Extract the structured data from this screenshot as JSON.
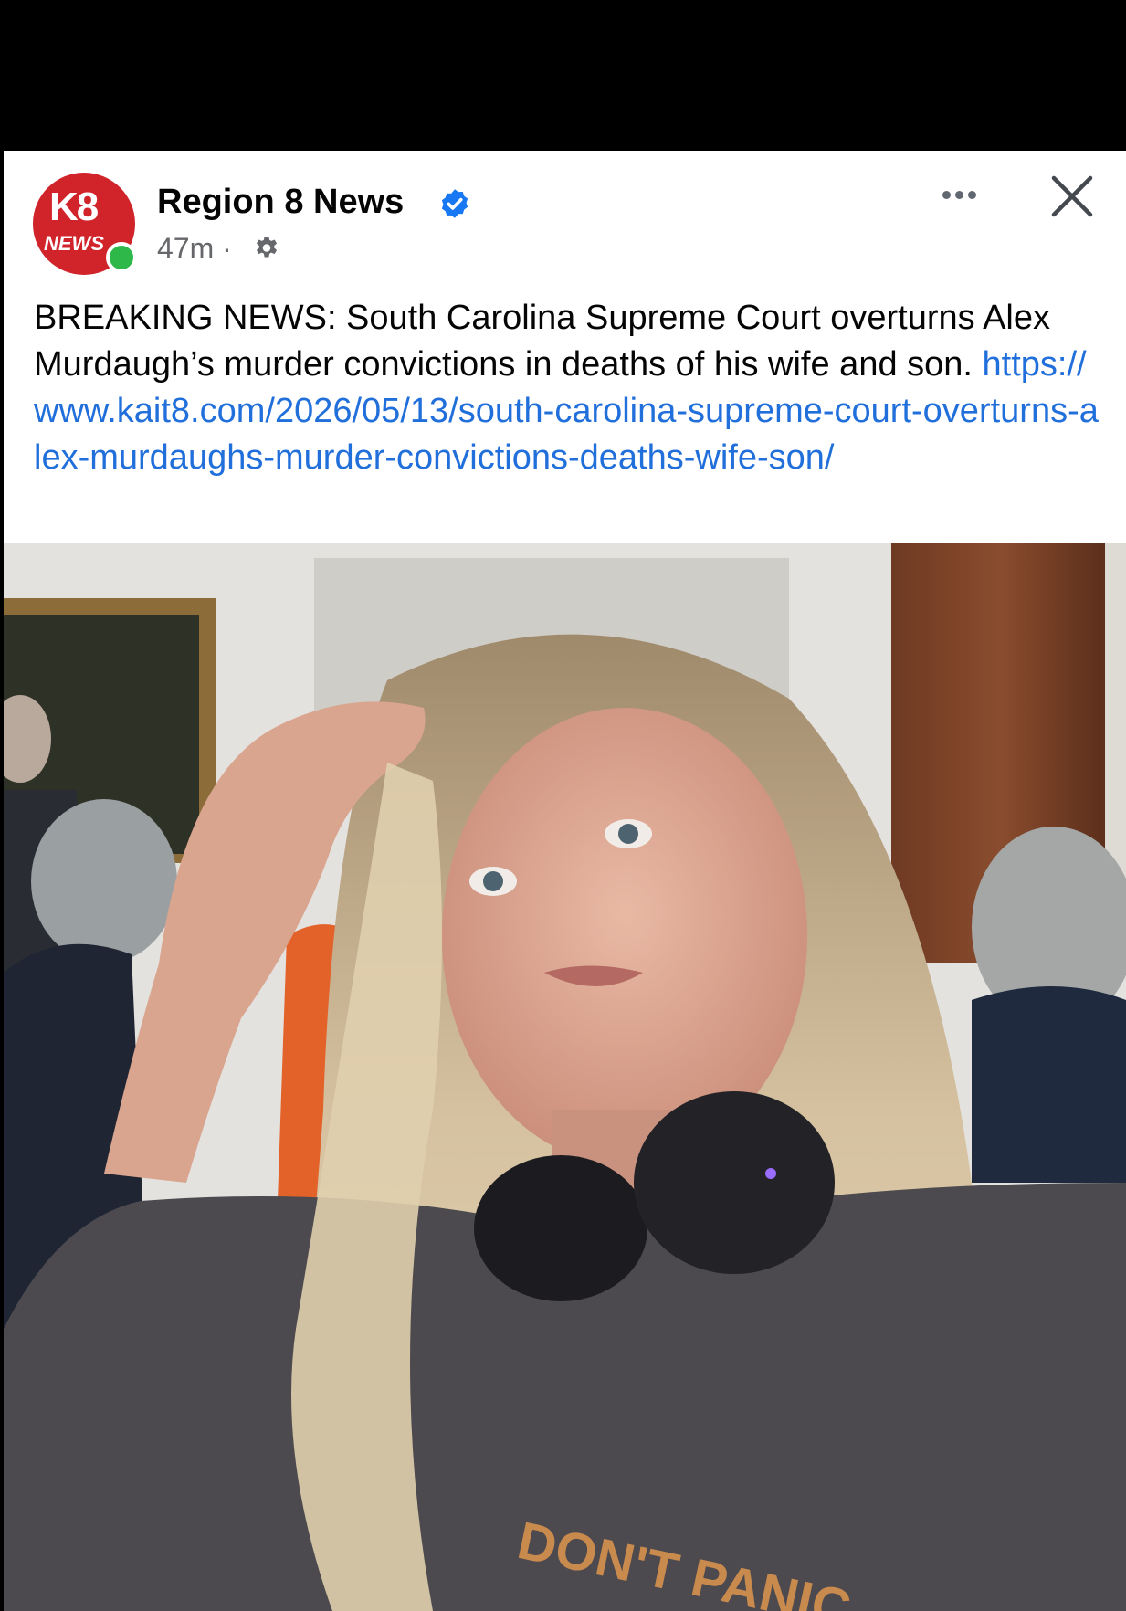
{
  "post": {
    "page_name": "Region 8 News",
    "timestamp": "47m",
    "separator": "·",
    "avatar": {
      "logo_top": "K8",
      "logo_bottom": "NEWS",
      "brand_color": "#d0232a",
      "online_color": "#2fb84a"
    },
    "body_text": "BREAKING NEWS: South Carolina Supreme Court overturns Alex Murdaugh’s murder convictions in deaths of his wife and son. ",
    "link": "https://www.kait8.com/2026/05/13/south-carolina-supreme-court-overturns-alex-murdaughs-murder-convictions-deaths-wife-son/",
    "link_color": "#216fdb",
    "icons": {
      "verified": "verified-badge-icon",
      "audience": "settings-gear-icon",
      "more": "more-options-icon",
      "close": "close-icon"
    }
  },
  "media": {
    "shirt_text": "DON'T PANIC"
  }
}
